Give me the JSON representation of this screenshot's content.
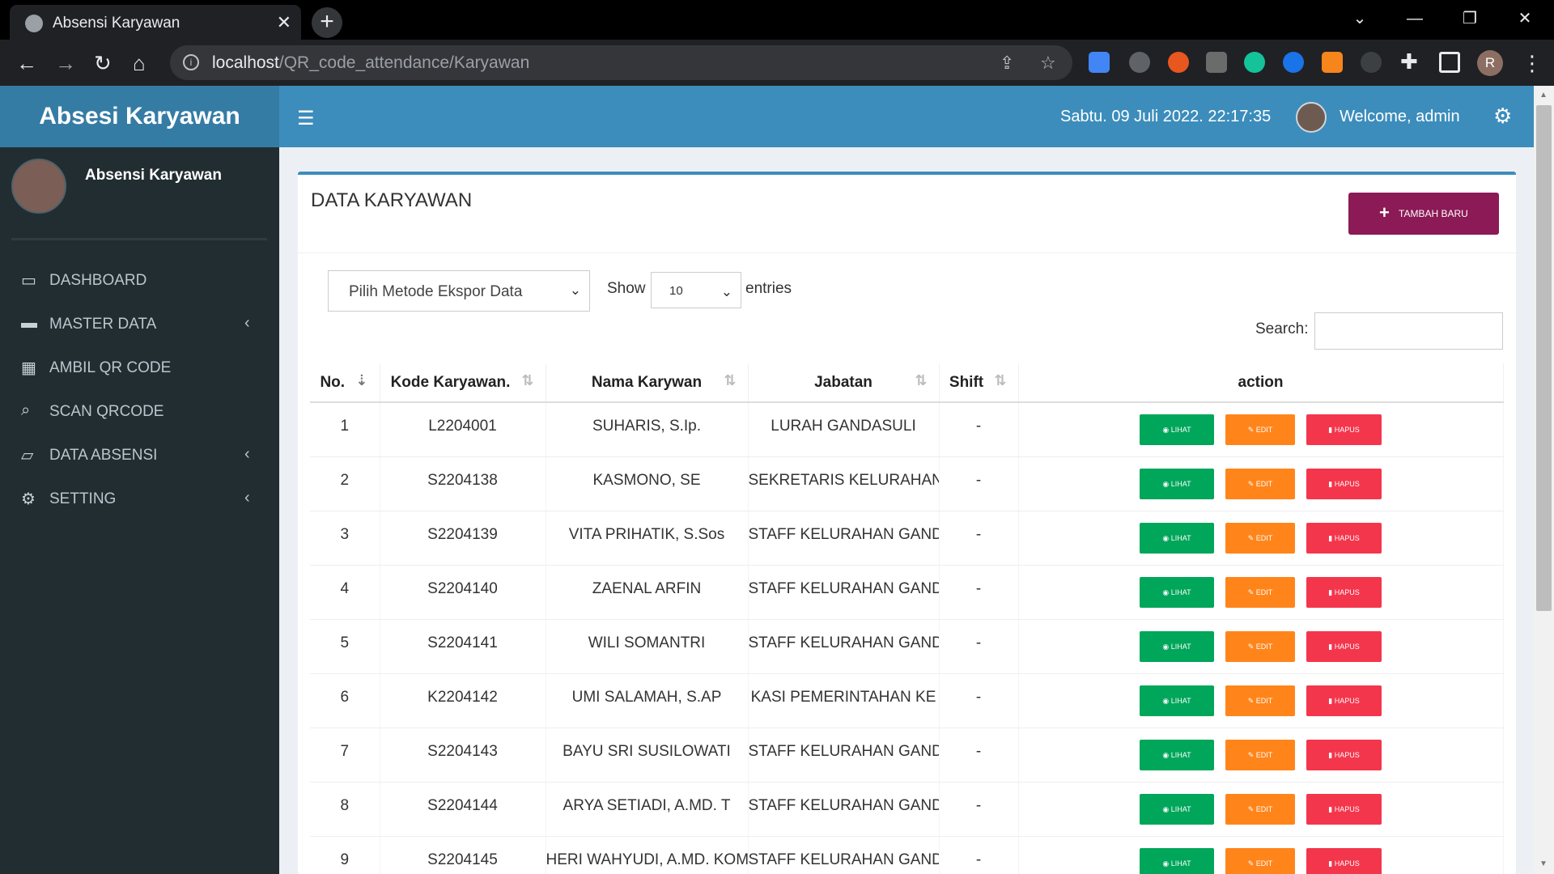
{
  "browser": {
    "tab_title": "Absensi Karyawan",
    "url_host": "localhost",
    "url_path": "/QR_code_attendance/Karyawan",
    "profile_initial": "R"
  },
  "header": {
    "brand": "Absesi Karyawan",
    "datetime": "Sabtu. 09 Juli 2022. 22:17:35",
    "welcome": "Welcome, admin"
  },
  "sidebar": {
    "user_name": "Absensi Karyawan",
    "items": [
      {
        "label": "DASHBOARD",
        "icon": "laptop-icon"
      },
      {
        "label": "MASTER DATA",
        "icon": "folder-icon"
      },
      {
        "label": "AMBIL QR CODE",
        "icon": "qrcode-icon"
      },
      {
        "label": "SCAN QRCODE",
        "icon": "search-plus-icon"
      },
      {
        "label": "DATA ABSENSI",
        "icon": "folder-open-icon"
      },
      {
        "label": "SETTING",
        "icon": "gears-icon"
      }
    ]
  },
  "main": {
    "title": "DATA KARYAWAN",
    "add_button": "TAMBAH BARU",
    "export_select": "Pilih Metode Ekspor Data",
    "show_label": "Show",
    "page_length": "10",
    "entries_label": "entries",
    "search_label": "Search:",
    "columns": [
      "No.",
      "Kode Karyawan.",
      "Nama Karywan",
      "Jabatan",
      "Shift",
      "action"
    ],
    "action_labels": {
      "view": "LIHAT",
      "edit": "EDIT",
      "delete": "HAPUS"
    },
    "rows": [
      {
        "no": "1",
        "kode": "L2204001",
        "nama": "SUHARIS, S.Ip.",
        "jabatan": "LURAH GANDASULI",
        "shift": "-"
      },
      {
        "no": "2",
        "kode": "S2204138",
        "nama": "KASMONO, SE",
        "jabatan": "SEKRETARIS KELURAHAN",
        "shift": "-"
      },
      {
        "no": "3",
        "kode": "S2204139",
        "nama": "VITA PRIHATIK, S.Sos",
        "jabatan": "STAFF KELURAHAN GAND",
        "shift": "-"
      },
      {
        "no": "4",
        "kode": "S2204140",
        "nama": "ZAENAL ARFIN",
        "jabatan": "STAFF KELURAHAN GAND",
        "shift": "-"
      },
      {
        "no": "5",
        "kode": "S2204141",
        "nama": "WILI SOMANTRI",
        "jabatan": "STAFF KELURAHAN GAND",
        "shift": "-"
      },
      {
        "no": "6",
        "kode": "K2204142",
        "nama": "UMI SALAMAH, S.AP",
        "jabatan": "KASI PEMERINTAHAN KE",
        "shift": "-"
      },
      {
        "no": "7",
        "kode": "S2204143",
        "nama": "BAYU SRI SUSILOWATI",
        "jabatan": "STAFF KELURAHAN GAND",
        "shift": "-"
      },
      {
        "no": "8",
        "kode": "S2204144",
        "nama": "ARYA SETIADI, A.MD. T",
        "jabatan": "STAFF KELURAHAN GAND",
        "shift": "-"
      },
      {
        "no": "9",
        "kode": "S2204145",
        "nama": "HERI WAHYUDI, A.MD. KOM",
        "jabatan": "STAFF KELURAHAN GAND",
        "shift": "-"
      }
    ]
  },
  "colors": {
    "header_blue": "#3c8dbc",
    "brand_blue": "#357ca5",
    "sidebar_dark": "#222d32",
    "add_button": "#8b1a56",
    "view_button": "#00a65a",
    "edit_button": "#ff851b",
    "delete_button": "#f4364c"
  }
}
